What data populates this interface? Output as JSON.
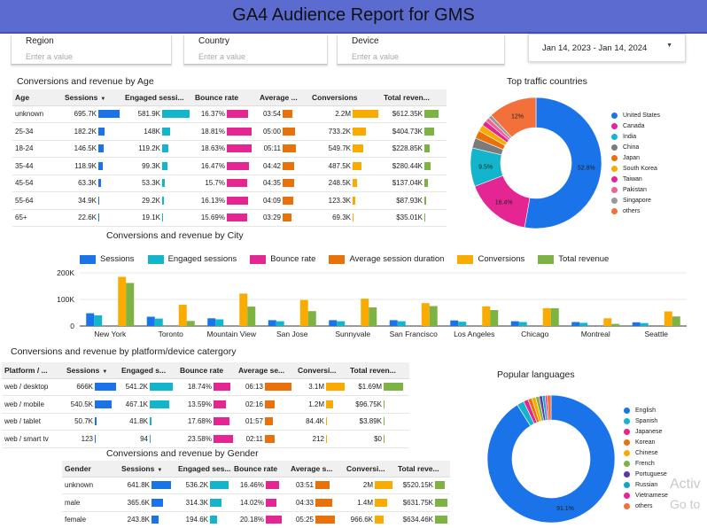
{
  "header": {
    "title": "GA4 Audience Report for GMS"
  },
  "filters": [
    {
      "label": "Region",
      "placeholder": "Enter a value"
    },
    {
      "label": "Country",
      "placeholder": "Enter a value"
    },
    {
      "label": "Device",
      "placeholder": "Enter a value"
    }
  ],
  "date_range": {
    "text": "Jan 14, 2023 - Jan 14, 2024",
    "caret": "▼"
  },
  "colors": {
    "header": "#5b6bd0",
    "sessions": "#1a73e8",
    "engaged": "#12b5cb",
    "bounce": "#e52592",
    "duration": "#e8710a",
    "conversions": "#f9ab00",
    "revenue": "#7cb342"
  },
  "age_table": {
    "title": "Conversions and revenue by Age",
    "columns": [
      "Age",
      "Sessions",
      "Engaged sessi...",
      "Bounce rate",
      "Average ...",
      "Conversions",
      "Total reven..."
    ],
    "sort_icon": "▼",
    "rows": [
      {
        "label": "unknown",
        "sessions": "695.7K",
        "engaged": "581.9K",
        "bounce": "16.37%",
        "duration": "03:54",
        "conversions": "2.2M",
        "revenue": "$612.35K",
        "f": [
          1.0,
          1.0,
          0.87,
          0.61,
          1.0,
          1.0
        ]
      },
      {
        "label": "25-34",
        "sessions": "182.2K",
        "engaged": "148K",
        "bounce": "18.81%",
        "duration": "05:00",
        "conversions": "733.2K",
        "revenue": "$404.73K",
        "f": [
          0.26,
          0.25,
          1.0,
          0.78,
          0.33,
          0.66
        ]
      },
      {
        "label": "18-24",
        "sessions": "146.5K",
        "engaged": "119.2K",
        "bounce": "18.63%",
        "duration": "05:11",
        "conversions": "549.7K",
        "revenue": "$228.85K",
        "f": [
          0.21,
          0.2,
          0.99,
          0.81,
          0.25,
          0.37
        ]
      },
      {
        "label": "35-44",
        "sessions": "118.9K",
        "engaged": "99.3K",
        "bounce": "16.47%",
        "duration": "04:42",
        "conversions": "487.5K",
        "revenue": "$280.44K",
        "f": [
          0.17,
          0.17,
          0.88,
          0.73,
          0.22,
          0.46
        ]
      },
      {
        "label": "45-54",
        "sessions": "63.3K",
        "engaged": "53.3K",
        "bounce": "15.7%",
        "duration": "04:35",
        "conversions": "248.5K",
        "revenue": "$137.04K",
        "f": [
          0.09,
          0.09,
          0.83,
          0.71,
          0.11,
          0.22
        ]
      },
      {
        "label": "55-64",
        "sessions": "34.9K",
        "engaged": "29.2K",
        "bounce": "16.13%",
        "duration": "04:09",
        "conversions": "123.3K",
        "revenue": "$87.93K",
        "f": [
          0.05,
          0.05,
          0.86,
          0.65,
          0.06,
          0.14
        ]
      },
      {
        "label": "65+",
        "sessions": "22.6K",
        "engaged": "19.1K",
        "bounce": "15.69%",
        "duration": "03:29",
        "conversions": "69.3K",
        "revenue": "$35.01K",
        "f": [
          0.03,
          0.03,
          0.83,
          0.55,
          0.03,
          0.06
        ]
      }
    ]
  },
  "countries": {
    "title": "Top traffic countries",
    "legend": [
      "United States",
      "Canada",
      "India",
      "China",
      "Japan",
      "South Korea",
      "Taiwan",
      "Pakistan",
      "Singapore",
      "others"
    ],
    "colors": [
      "#1a73e8",
      "#e52592",
      "#12b5cb",
      "#7b7b7b",
      "#e8710a",
      "#f9ab00",
      "#e52592",
      "#f06292",
      "#999999",
      "#f4703a"
    ],
    "values": [
      52.8,
      16.4,
      9.5,
      2.5,
      2.0,
      1.6,
      1.3,
      1.0,
      0.9,
      12
    ],
    "labels": [
      "52.8%",
      "16.4%",
      "9.5%",
      "",
      "",
      "",
      "",
      "",
      "",
      "12%"
    ]
  },
  "city_chart": {
    "title": "Conversions and revenue by City",
    "legend": [
      "Sessions",
      "Engaged sessions",
      "Bounce rate",
      "Average session duration",
      "Conversions",
      "Total revenue"
    ],
    "yticks": [
      "200K",
      "100K",
      "0"
    ],
    "chart_data": {
      "type": "bar",
      "categories": [
        "New York",
        "Toronto",
        "Mountain View",
        "San Jose",
        "Sunnyvale",
        "San Francisco",
        "Los Angeles",
        "Chicago",
        "Montreal",
        "Seattle"
      ],
      "ylim": [
        0,
        200000
      ],
      "series": [
        {
          "name": "Sessions",
          "values": [
            48000,
            35000,
            29000,
            22000,
            22000,
            22000,
            21000,
            18000,
            15000,
            14000
          ]
        },
        {
          "name": "Engaged sessions",
          "values": [
            40000,
            28000,
            25000,
            18000,
            18000,
            18000,
            16000,
            15000,
            12000,
            11000
          ]
        },
        {
          "name": "Bounce rate",
          "values": [
            0,
            0,
            0,
            0,
            0,
            0,
            0,
            0,
            0,
            0
          ]
        },
        {
          "name": "Average session duration",
          "values": [
            0,
            0,
            0,
            0,
            0,
            0,
            0,
            0,
            0,
            0
          ]
        },
        {
          "name": "Conversions",
          "values": [
            185000,
            80000,
            122000,
            98000,
            103000,
            86000,
            74000,
            67000,
            29000,
            55000
          ]
        },
        {
          "name": "Total revenue",
          "values": [
            162000,
            19000,
            73000,
            56000,
            70000,
            75000,
            60000,
            67000,
            8000,
            36000
          ]
        }
      ]
    }
  },
  "platform_table": {
    "title": "Conversions and revenue by platform/device catergory",
    "columns": [
      "Platform / ...",
      "Sessions",
      "Engaged s...",
      "Bounce rate",
      "Average se...",
      "Conversi...",
      "Total reven..."
    ],
    "sort_icon": "▼",
    "rows": [
      {
        "label": "web / desktop",
        "sessions": "666K",
        "engaged": "541.2K",
        "bounce": "18.74%",
        "duration": "06:13",
        "conversions": "3.1M",
        "revenue": "$1.69M",
        "f": [
          1.0,
          1.0,
          0.8,
          1.0,
          1.0,
          1.0
        ]
      },
      {
        "label": "web / mobile",
        "sessions": "540.5K",
        "engaged": "467.1K",
        "bounce": "13.59%",
        "duration": "02:16",
        "conversions": "1.2M",
        "revenue": "$96.75K",
        "f": [
          0.81,
          0.86,
          0.58,
          0.37,
          0.38,
          0.06
        ]
      },
      {
        "label": "web / tablet",
        "sessions": "50.7K",
        "engaged": "41.8K",
        "bounce": "17.68%",
        "duration": "01:57",
        "conversions": "84.4K",
        "revenue": "$3.89K",
        "f": [
          0.08,
          0.08,
          0.75,
          0.31,
          0.03,
          0.0
        ]
      },
      {
        "label": "web / smart tv",
        "sessions": "123",
        "engaged": "94",
        "bounce": "23.58%",
        "duration": "02:11",
        "conversions": "212",
        "revenue": "$0",
        "f": [
          0.0,
          0.0,
          1.0,
          0.35,
          0.0,
          0.0
        ]
      }
    ]
  },
  "gender_table": {
    "title": "Conversions and revenue by Gender",
    "columns": [
      "Gender",
      "Sessions",
      "Engaged ses...",
      "Bounce rate",
      "Average s...",
      "Conversi...",
      "Total reve..."
    ],
    "sort_icon": "▼",
    "rows": [
      {
        "label": "unknown",
        "sessions": "641.8K",
        "engaged": "536.2K",
        "bounce": "16.46%",
        "duration": "03:51",
        "conversions": "2M",
        "revenue": "$520.15K",
        "f": [
          1.0,
          1.0,
          0.82,
          0.72,
          1.0,
          0.82
        ]
      },
      {
        "label": "male",
        "sessions": "365.6K",
        "engaged": "314.3K",
        "bounce": "14.02%",
        "duration": "04:33",
        "conversions": "1.4M",
        "revenue": "$631.75K",
        "f": [
          0.57,
          0.59,
          0.69,
          0.85,
          0.7,
          1.0
        ]
      },
      {
        "label": "female",
        "sessions": "243.8K",
        "engaged": "194.6K",
        "bounce": "20.18%",
        "duration": "05:25",
        "conversions": "966.6K",
        "revenue": "$634.46K",
        "f": [
          0.38,
          0.36,
          1.0,
          1.0,
          0.48,
          1.0
        ]
      }
    ]
  },
  "languages": {
    "title": "Popular languages",
    "legend": [
      "English",
      "Spanish",
      "Japanese",
      "Korean",
      "Chinese",
      "French",
      "Portuguese",
      "Russian",
      "Vietnamese",
      "others"
    ],
    "colors": [
      "#1a73e8",
      "#12b5cb",
      "#e52592",
      "#e8710a",
      "#f9ab00",
      "#7cb342",
      "#5e35b1",
      "#12a4cb",
      "#e52592",
      "#f4703a"
    ],
    "values": [
      91.1,
      1.8,
      1.2,
      1.0,
      1.0,
      0.9,
      0.8,
      0.7,
      0.5,
      1.0
    ],
    "labels": [
      "91.1%",
      "",
      "",
      "",
      "",
      "",
      "",
      "",
      "",
      ""
    ]
  },
  "watermark": {
    "line1": "Activ",
    "line2": "Go to"
  }
}
